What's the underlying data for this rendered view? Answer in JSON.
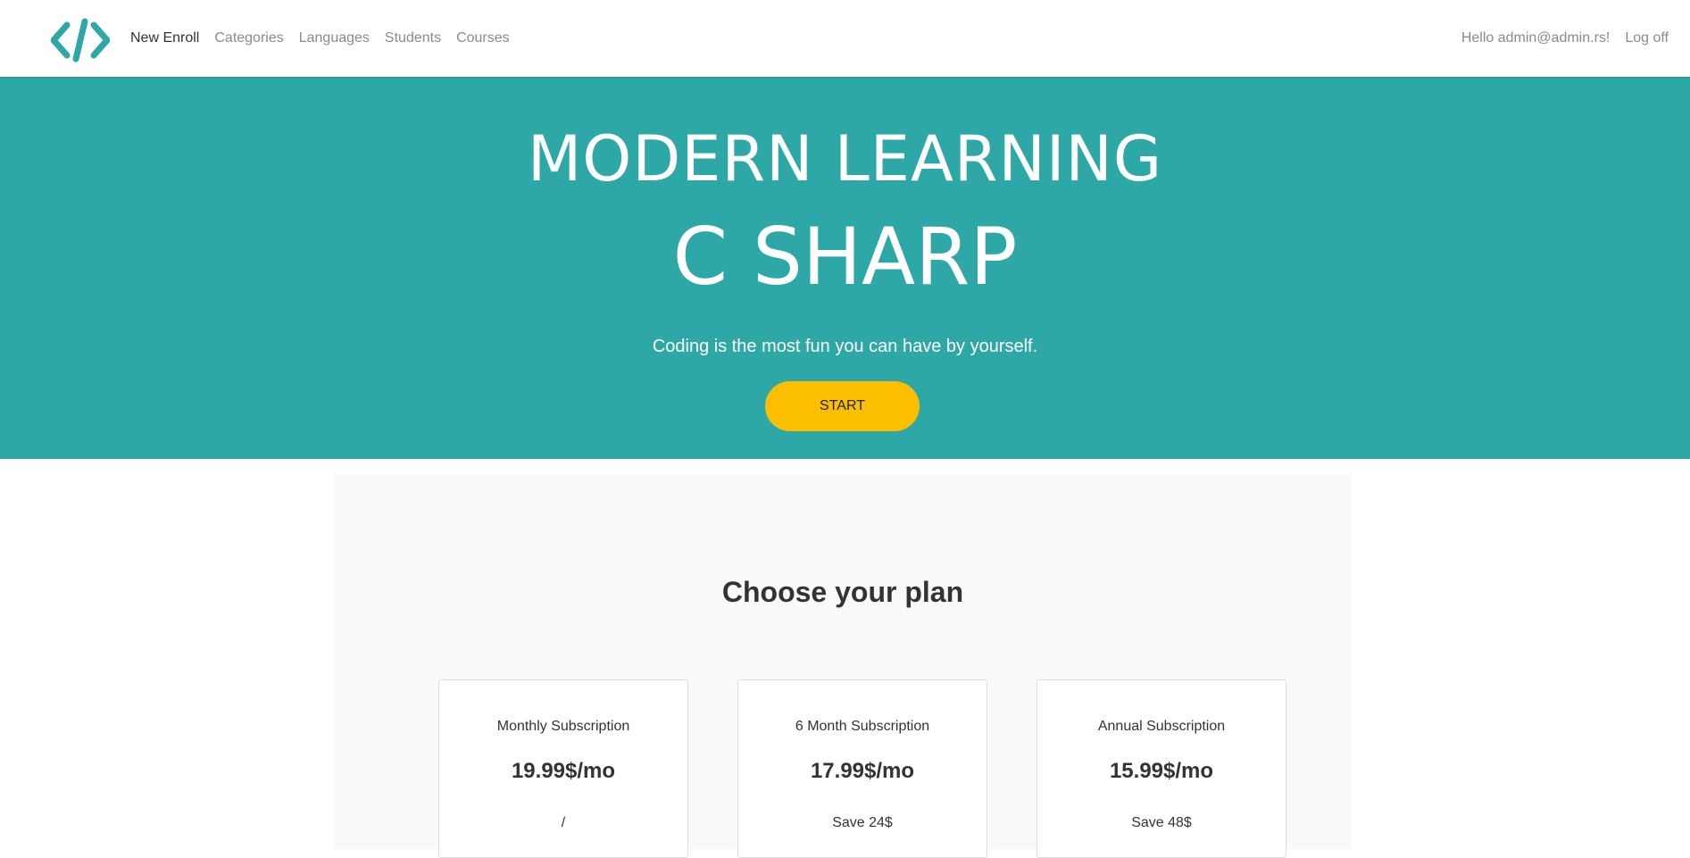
{
  "navbar": {
    "logo_icon": "code-brackets-icon",
    "links": [
      {
        "label": "New Enroll"
      },
      {
        "label": "Categories"
      },
      {
        "label": "Languages"
      },
      {
        "label": "Students"
      },
      {
        "label": "Courses"
      }
    ],
    "greeting": "Hello admin@admin.rs!",
    "logoff": "Log off"
  },
  "hero": {
    "title": "MODERN LEARNING",
    "subtitle": "C SHARP",
    "tagline": "Coding is the most fun you can have by yourself.",
    "start_label": "START"
  },
  "pricing": {
    "heading": "Choose your plan",
    "plans": [
      {
        "name": "Monthly Subscription",
        "price": "19.99$/mo",
        "save": "/"
      },
      {
        "name": "6 Month Subscription",
        "price": "17.99$/mo",
        "save": "Save 24$"
      },
      {
        "name": "Annual Subscription",
        "price": "15.99$/mo",
        "save": "Save 48$"
      }
    ]
  },
  "colors": {
    "accent": "#2ea8a6",
    "button": "#fbbf00",
    "text": "#333333",
    "muted": "#8a8a8a"
  }
}
